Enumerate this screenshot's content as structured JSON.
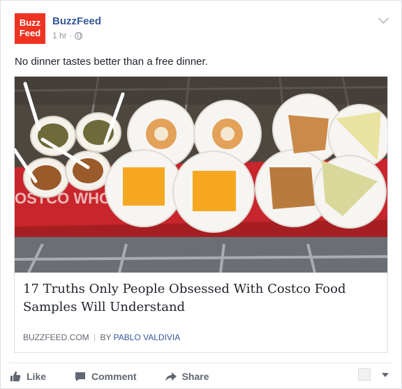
{
  "post": {
    "logo_line1": "Buzz",
    "logo_line2": "Feed",
    "page_name": "BuzzFeed",
    "time": "1 hr ·",
    "text": "No dinner tastes better than a free dinner."
  },
  "link": {
    "headline": "17 Truths Only People Obsessed With Costco Food Samples Will Understand",
    "domain": "BUZZFEED.COM",
    "separator": "|",
    "by": "BY",
    "author": "PABLO VALDIVIA",
    "cart_text": "OSTCO WHOL"
  },
  "actions": {
    "like": "Like",
    "comment": "Comment",
    "share": "Share"
  },
  "colors": {
    "brand": "#ee3322",
    "link": "#365899",
    "cart_red": "#c8262c"
  }
}
